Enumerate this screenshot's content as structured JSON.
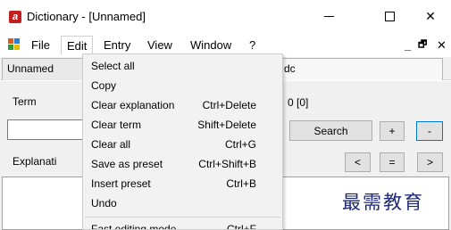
{
  "window": {
    "title": "Dictionary - [Unnamed]",
    "app_icon_letter": "a",
    "minimize_icon": "minimize-icon",
    "maximize_icon": "maximize-icon",
    "close_glyph": "✕"
  },
  "menubar": {
    "items": [
      "File",
      "Edit",
      "Entry",
      "View",
      "Window",
      "?"
    ],
    "mdi_minimize": "_",
    "mdi_restore": "🗗",
    "mdi_close": "✕"
  },
  "tabs": {
    "first": "Unnamed",
    "second": "dc"
  },
  "main": {
    "term_label": "Term",
    "term_value": "",
    "count_text": "0 [0]",
    "explanation_label": "Explanati",
    "search_label": "Search",
    "plus_label": "+",
    "minus_label": "-",
    "prev_label": "<",
    "eq_label": "=",
    "next_label": ">",
    "watermark": "最需教育"
  },
  "edit_menu": {
    "items": [
      {
        "label": "Select all",
        "shortcut": ""
      },
      {
        "label": "Copy",
        "shortcut": ""
      },
      {
        "label": "Clear explanation",
        "shortcut": "Ctrl+Delete"
      },
      {
        "label": "Clear term",
        "shortcut": "Shift+Delete"
      },
      {
        "label": "Clear all",
        "shortcut": "Ctrl+G"
      },
      {
        "label": "Save as preset",
        "shortcut": "Ctrl+Shift+B"
      },
      {
        "label": "Insert preset",
        "shortcut": "Ctrl+B"
      },
      {
        "label": "Undo",
        "shortcut": ""
      },
      {
        "label": "Fast editing mode",
        "shortcut": "Ctrl+F"
      }
    ]
  },
  "colors": {
    "accent": "#0078d7",
    "app_icon": "#c41e1e",
    "watermark": "#1e2a78"
  }
}
